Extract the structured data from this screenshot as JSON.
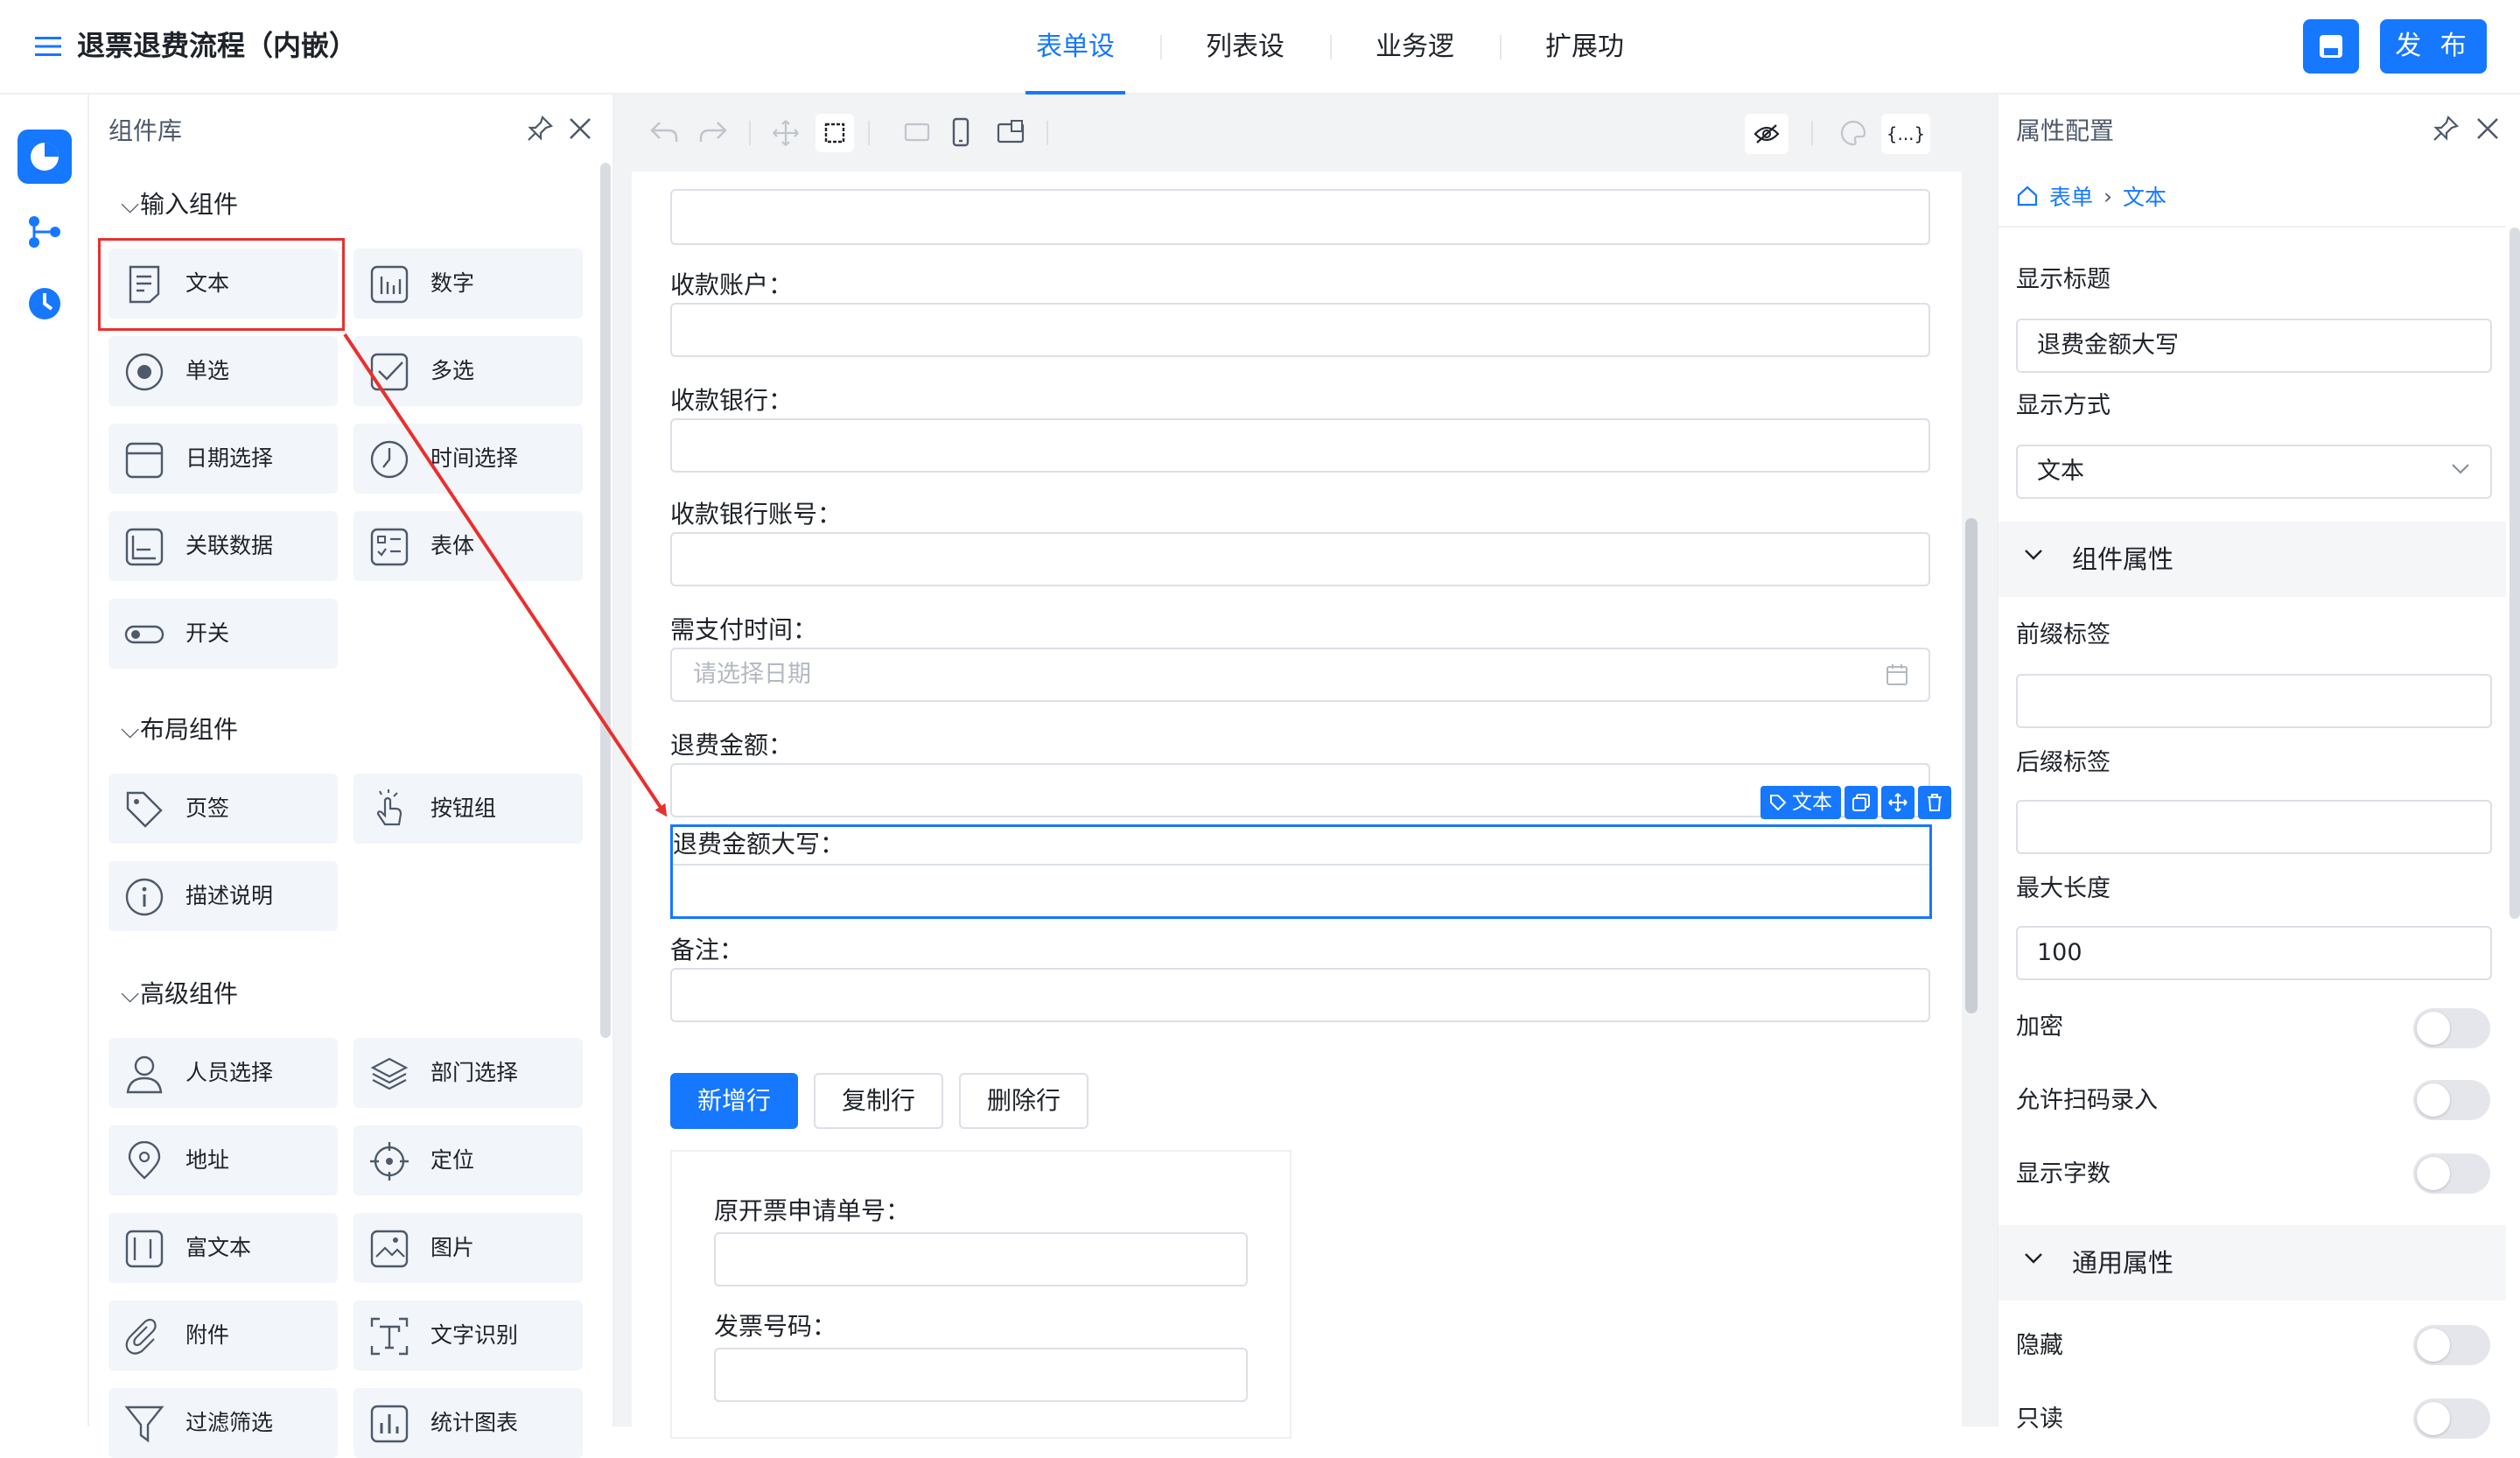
{
  "header": {
    "title": "退票退费流程（内嵌）",
    "tabs": [
      {
        "label": "表单设计",
        "active": true
      },
      {
        "label": "列表设计",
        "active": false
      },
      {
        "label": "业务逻辑",
        "active": false
      },
      {
        "label": "扩展功能",
        "active": false
      }
    ],
    "publish_label": "发 布"
  },
  "library": {
    "title": "组件库",
    "sections": [
      {
        "title": "输入组件",
        "items": [
          "文本",
          "数字",
          "单选",
          "多选",
          "日期选择",
          "时间选择",
          "关联数据",
          "表体",
          "开关"
        ]
      },
      {
        "title": "布局组件",
        "items": [
          "页签",
          "按钮组",
          "描述说明"
        ]
      },
      {
        "title": "高级组件",
        "items": [
          "人员选择",
          "部门选择",
          "地址",
          "定位",
          "富文本",
          "图片",
          "附件",
          "文字识别",
          "过滤筛选",
          "统计图表"
        ]
      }
    ]
  },
  "form": {
    "fields": [
      {
        "label": "收款账户："
      },
      {
        "label": "收款银行："
      },
      {
        "label": "收款银行账号："
      },
      {
        "label": "需支付时间：",
        "placeholder": "请选择日期"
      },
      {
        "label": "退费金额："
      },
      {
        "label": "退费金额大写："
      },
      {
        "label": "备注："
      }
    ],
    "selected_badge": "文本",
    "buttons": {
      "add_row": "新增行",
      "copy_row": "复制行",
      "delete_row": "删除行"
    },
    "subform_fields": [
      {
        "label": "原开票申请单号："
      },
      {
        "label": "发票号码："
      }
    ]
  },
  "props": {
    "title": "属性配置",
    "breadcrumb": [
      "表单",
      "文本"
    ],
    "show_title_label": "显示标题",
    "show_title_value": "退费金额大写",
    "display_mode_label": "显示方式",
    "display_mode_value": "文本",
    "component_group": "组件属性",
    "prefix_label": "前缀标签",
    "suffix_label": "后缀标签",
    "max_length_label": "最大长度",
    "max_length_value": "100",
    "encrypt_label": "加密",
    "scan_label": "允许扫码录入",
    "show_count_label": "显示字数",
    "common_group": "通用属性",
    "hidden_label": "隐藏",
    "readonly_label": "只读"
  }
}
